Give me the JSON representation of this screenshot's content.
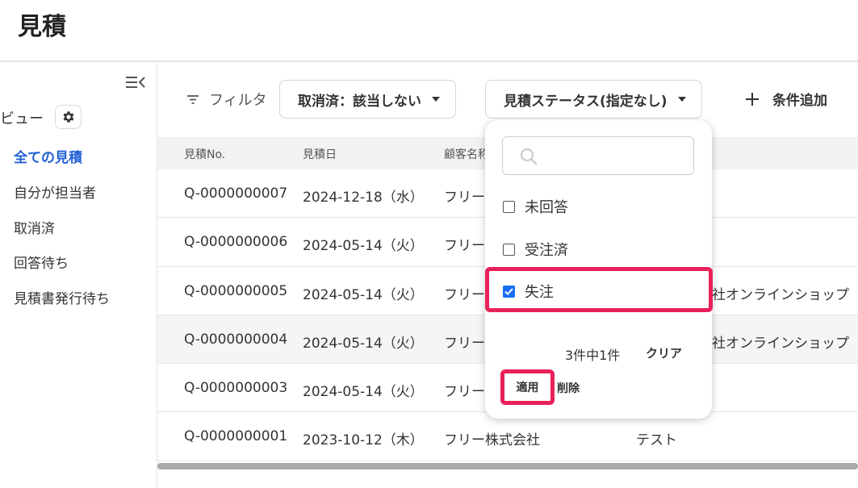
{
  "page": {
    "title": "見積"
  },
  "sidebar": {
    "view_label": "ビュー",
    "items": [
      {
        "label": "全ての見積",
        "active": true
      },
      {
        "label": "自分が担当者",
        "active": false
      },
      {
        "label": "取消済",
        "active": false
      },
      {
        "label": "回答待ち",
        "active": false
      },
      {
        "label": "見積書発行待ち",
        "active": false
      }
    ]
  },
  "filter": {
    "label": "フィルタ",
    "chips": [
      {
        "label": "取消済：該当しない"
      },
      {
        "label": "見積ステータス(指定なし)"
      }
    ],
    "add_condition_label": "条件追加"
  },
  "table": {
    "columns": [
      "見積No.",
      "見積日",
      "顧客名称"
    ],
    "rows": [
      {
        "no": "Q-0000000007",
        "date": "2024-12-18（水）",
        "customer": "フリー",
        "extra": ""
      },
      {
        "no": "Q-0000000006",
        "date": "2024-05-14（火）",
        "customer": "フリー",
        "extra": ""
      },
      {
        "no": "Q-0000000005",
        "date": "2024-05-14（火）",
        "customer": "フリー",
        "extra": "会社オンラインショップ"
      },
      {
        "no": "Q-0000000004",
        "date": "2024-05-14（火）",
        "customer": "フリー",
        "extra": "会社オンラインショップ"
      },
      {
        "no": "Q-0000000003",
        "date": "2024-05-14（火）",
        "customer": "フリー",
        "extra": ""
      },
      {
        "no": "Q-0000000001",
        "date": "2023-10-12（木）",
        "customer": "フリー株式会社",
        "extra": "テスト"
      }
    ]
  },
  "status_popup": {
    "search_placeholder": "",
    "options": [
      {
        "label": "未回答",
        "checked": false
      },
      {
        "label": "受注済",
        "checked": false
      },
      {
        "label": "失注",
        "checked": true
      }
    ],
    "count_text": "3件中1件",
    "clear_label": "クリア",
    "apply_label": "適用",
    "delete_label": "削除"
  },
  "colors": {
    "accent": "#2160d6",
    "highlight": "#e8215a",
    "checkbox": "#1a6ff0"
  }
}
